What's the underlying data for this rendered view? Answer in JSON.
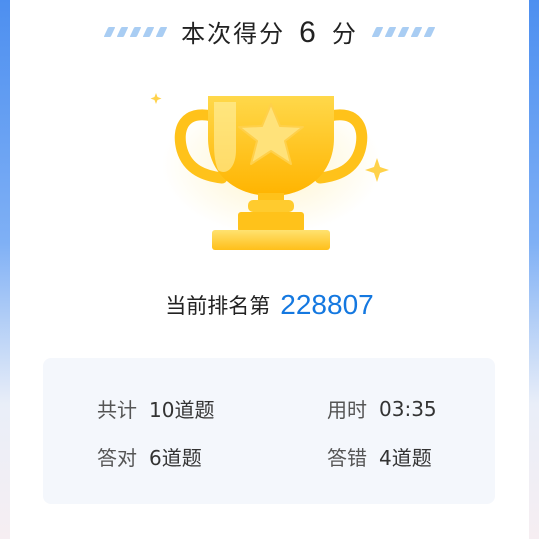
{
  "result": {
    "score_prefix": "本次得分",
    "score_value": "6",
    "score_suffix": "分"
  },
  "ranking": {
    "label": "当前排名第",
    "value": "228807"
  },
  "stats": {
    "total_label": "共计",
    "total_value": "10道题",
    "time_label": "用时",
    "time_value": "03:35",
    "correct_label": "答对",
    "correct_value": "6道题",
    "wrong_label": "答错",
    "wrong_value": "4道题"
  },
  "colors": {
    "accent": "#1478e0",
    "trophy_gold": "#ffc21a",
    "background_blue": "#4d8ff0"
  },
  "icons": {
    "trophy": "trophy-icon",
    "star": "star-icon",
    "sparkle": "sparkle-icon"
  }
}
